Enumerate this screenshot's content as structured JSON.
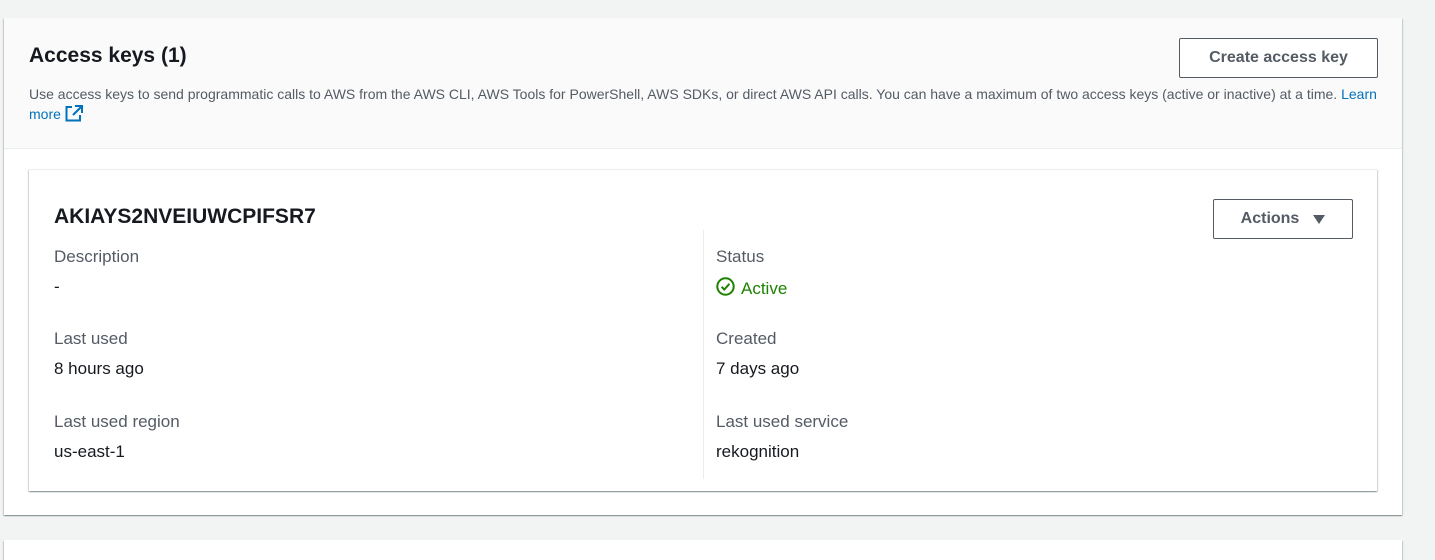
{
  "access_keys": {
    "title": "Access keys (1)",
    "description": "Use access keys to send programmatic calls to AWS from the AWS CLI, AWS Tools for PowerShell, AWS SDKs, or direct AWS API calls. You can have a maximum of two access keys (active or inactive) at a time.",
    "learn_more_label": "Learn more",
    "create_button_label": "Create access key"
  },
  "key": {
    "id": "AKIAYS2NVEIUWCPIFSR7",
    "actions_label": "Actions",
    "fields": {
      "description_label": "Description",
      "description_value": "-",
      "last_used_label": "Last used",
      "last_used_value": "8 hours ago",
      "last_used_region_label": "Last used region",
      "last_used_region_value": "us-east-1",
      "status_label": "Status",
      "status_value": "Active",
      "created_label": "Created",
      "created_value": "7 days ago",
      "last_used_service_label": "Last used service",
      "last_used_service_value": "rekognition"
    }
  },
  "icons": {
    "external_link": "external-link-icon",
    "status_active": "check-circle-icon",
    "dropdown": "caret-down-icon"
  },
  "colors": {
    "link": "#0073bb",
    "status_active": "#1d8102",
    "button_border": "#545b64",
    "background": "#f2f3f3"
  }
}
